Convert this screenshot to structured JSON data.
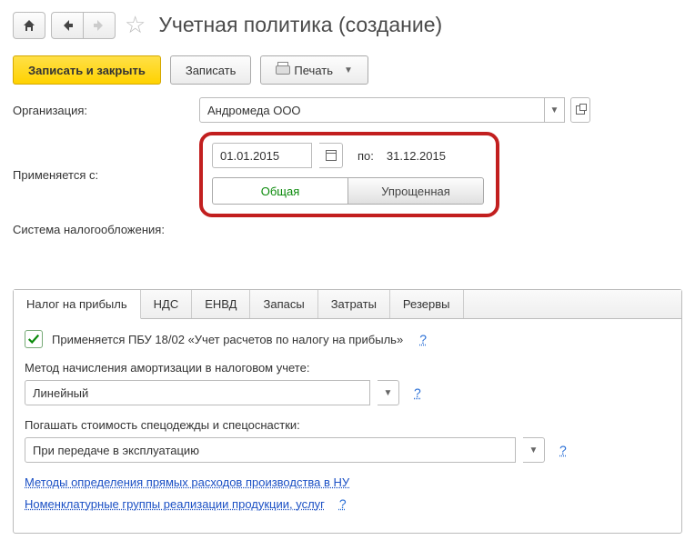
{
  "header": {
    "title": "Учетная политика (создание)"
  },
  "actions": {
    "save_close": "Записать и закрыть",
    "save": "Записать",
    "print": "Печать"
  },
  "form": {
    "org_label": "Организация:",
    "org_value": "Андромеда ООО",
    "applied_label": "Применяется с:",
    "date_from": "01.01.2015",
    "date_to_label": "по:",
    "date_to": "31.12.2015",
    "tax_system_label": "Система налогообложения:",
    "tax_system_options": {
      "general": "Общая",
      "simplified": "Упрощенная"
    }
  },
  "tabs": [
    "Налог на прибыль",
    "НДС",
    "ЕНВД",
    "Запасы",
    "Затраты",
    "Резервы"
  ],
  "profit_tab": {
    "pbu_label": "Применяется ПБУ 18/02 «Учет расчетов по налогу на прибыль»",
    "amort_label": "Метод начисления амортизации в налоговом учете:",
    "amort_value": "Линейный",
    "cloth_label": "Погашать стоимость спецодежды и спецоснастки:",
    "cloth_value": "При передаче в эксплуатацию",
    "link1": "Методы определения прямых расходов производства в НУ",
    "link2": "Номенклатурные группы реализации продукции, услуг",
    "help": "?"
  }
}
